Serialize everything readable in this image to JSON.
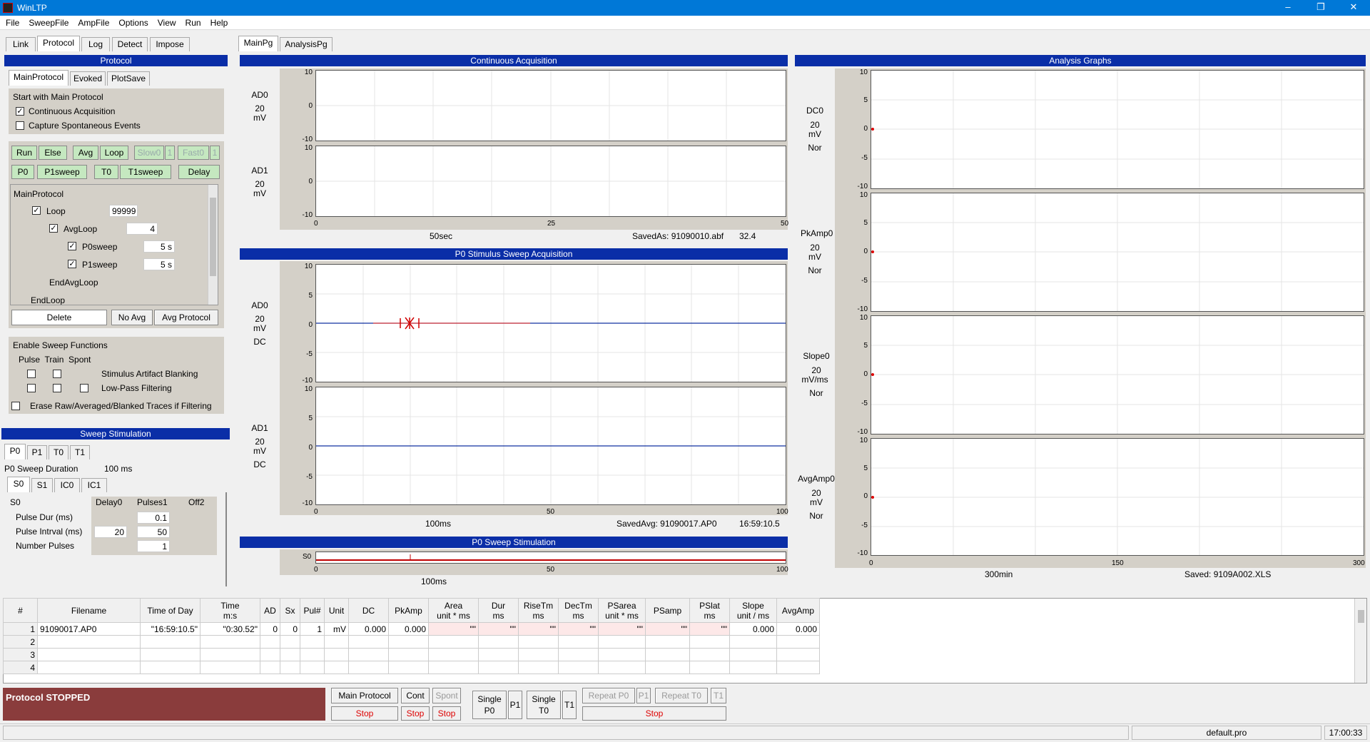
{
  "app": {
    "title": "WinLTP",
    "min": "–",
    "restore": "❐",
    "close": "✕"
  },
  "menu": [
    "File",
    "SweepFile",
    "AmpFile",
    "Options",
    "View",
    "Run",
    "Help"
  ],
  "lefttabs": [
    "Link",
    "Protocol",
    "Log",
    "Detect",
    "Impose"
  ],
  "protocol": {
    "header": "Protocol",
    "subtabs": [
      "MainProtocol",
      "Evoked",
      "PlotSave"
    ],
    "start_label": "Start with Main Protocol",
    "continuous": "Continuous Acquisition",
    "capture": "Capture Spontaneous Events",
    "buttons": {
      "run": "Run",
      "else": "Else",
      "avg": "Avg",
      "loop": "Loop",
      "slow": "Slow0",
      "slow_n": "1",
      "fast": "Fast0",
      "fast_n": "1",
      "p0": "P0",
      "p1sweep": "P1sweep",
      "t0": "T0",
      "t1sweep": "T1sweep",
      "delay": "Delay"
    },
    "tree": {
      "main": "MainProtocol",
      "loop": "Loop",
      "loop_val": "99999",
      "avgloop": "AvgLoop",
      "avgloop_val": "4",
      "p0sweep": "P0sweep",
      "p0_val": "5 s",
      "p1sweep": "P1sweep",
      "p1_val": "5 s",
      "endavg": "EndAvgLoop",
      "endloop": "EndLoop"
    },
    "delete": "Delete",
    "noavg": "No Avg",
    "avgprotocol": "Avg Protocol",
    "sweepfunc": {
      "title": "Enable Sweep Functions",
      "cols": "Pulse  Train  Spont",
      "blanking": "Stimulus Artifact Blanking",
      "lowpass": "Low-Pass Filtering",
      "erase": "Erase Raw/Averaged/Blanked Traces if Filtering"
    }
  },
  "stim": {
    "header": "Sweep Stimulation",
    "tabs": [
      "P0",
      "P1",
      "T0",
      "T1"
    ],
    "duration_label": "P0 Sweep Duration",
    "duration": "100 ms",
    "subtabs": [
      "S0",
      "S1",
      "IC0",
      "IC1"
    ],
    "s0": "S0",
    "delay0": "Delay0",
    "pulses1": "Pulses1",
    "off2": "Off2",
    "pulsedur": "Pulse Dur (ms)",
    "pulsedur_val": "0.1",
    "interval": "Pulse Intrval (ms)",
    "interval_d": "20",
    "interval_val": "50",
    "npulses": "Number Pulses",
    "npulses_val": "1"
  },
  "maintabs": [
    "MainPg",
    "AnalysisPg"
  ],
  "cont": {
    "header": "Continuous Acquisition",
    "ch0": "AD0",
    "ch0_scale": "20",
    "ch0_unit": "mV",
    "ch1": "AD1",
    "ch1_scale": "20",
    "ch1_unit": "mV",
    "y_top": "10",
    "y_mid": "0",
    "y_bot": "-10",
    "x0": "0",
    "x1": "25",
    "x2": "50",
    "time": "50sec",
    "saved": "SavedAs: 91090010.abf",
    "savedval": "32.4"
  },
  "p0acq": {
    "header": "P0 Stimulus Sweep Acquisition",
    "ch0": "AD0",
    "ch0_scale": "20",
    "ch0_unit": "mV",
    "ch0_mode": "DC",
    "ch1": "AD1",
    "ch1_scale": "20",
    "ch1_unit": "mV",
    "ch1_mode": "DC",
    "y": [
      "10",
      "5",
      "0",
      "-5",
      "-10"
    ],
    "x0": "0",
    "x1": "50",
    "x2": "100",
    "time": "100ms",
    "saved": "SavedAvg: 91090017.AP0",
    "savedtime": "16:59:10.5"
  },
  "p0stim": {
    "header": "P0 Sweep Stimulation",
    "ch": "S0",
    "x0": "0",
    "x1": "50",
    "x2": "100",
    "time": "100ms"
  },
  "analysis": {
    "header": "Analysis Graphs",
    "graphs": [
      {
        "name": "DC0",
        "scale": "20",
        "unit": "mV",
        "mode": "Nor"
      },
      {
        "name": "PkAmp0",
        "scale": "20",
        "unit": "mV",
        "mode": "Nor"
      },
      {
        "name": "Slope0",
        "scale": "20",
        "unit": "mV/ms",
        "mode": "Nor"
      },
      {
        "name": "AvgAmp0",
        "scale": "20",
        "unit": "mV",
        "mode": "Nor"
      }
    ],
    "y": [
      "10",
      "5",
      "0",
      "-5",
      "-10"
    ],
    "x0": "0",
    "x1": "150",
    "x2": "300",
    "time": "300min",
    "saved": "Saved: 9109A002.XLS"
  },
  "table": {
    "headers": [
      "#",
      "Filename",
      "Time of Day",
      "Time\nm:s",
      "AD",
      "Sx",
      "Pul#",
      "Unit",
      "DC",
      "PkAmp",
      "Area\nunit * ms",
      "Dur\nms",
      "RiseTm\nms",
      "DecTm\nms",
      "PSarea\nunit * ms",
      "PSamp",
      "PSlat\nms",
      "Slope\nunit / ms",
      "AvgAmp"
    ],
    "rows": [
      [
        "1",
        "91090017.AP0",
        "\"16:59:10.5\"",
        "\"0:30.52\"",
        "0",
        "0",
        "1",
        "mV",
        "0.000",
        "0.000",
        "\"\"",
        "\"\"",
        "\"\"",
        "\"\"",
        "\"\"",
        "\"\"",
        "\"\"",
        "0.000",
        "0.000"
      ],
      [
        "2",
        "",
        "",
        "",
        "",
        "",
        "",
        "",
        "",
        "",
        "",
        "",
        "",
        "",
        "",
        "",
        "",
        "",
        ""
      ],
      [
        "3",
        "",
        "",
        "",
        "",
        "",
        "",
        "",
        "",
        "",
        "",
        "",
        "",
        "",
        "",
        "",
        "",
        "",
        ""
      ],
      [
        "4",
        "",
        "",
        "",
        "",
        "",
        "",
        "",
        "",
        "",
        "",
        "",
        "",
        "",
        "",
        "",
        "",
        "",
        ""
      ]
    ]
  },
  "bottom": {
    "status": "Protocol STOPPED",
    "mainprotocol": "Main Protocol",
    "cont": "Cont",
    "spont": "Spont",
    "stop": "Stop",
    "single_p0": "Single\nP0",
    "p1": "P1",
    "single_t0": "Single\nT0",
    "t1": "T1",
    "repeat_p0": "Repeat P0",
    "p1b": "P1",
    "repeat_t0": "Repeat T0",
    "t1b": "T1"
  },
  "statusbar": {
    "file": "default.pro",
    "time": "17:00:33"
  }
}
